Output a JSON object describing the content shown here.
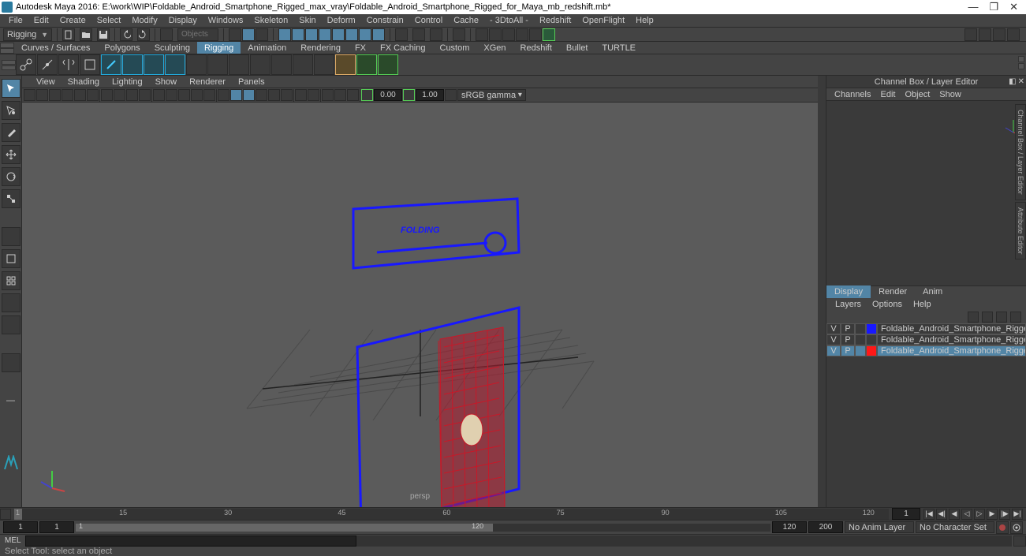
{
  "title": "Autodesk Maya 2016: E:\\work\\WIP\\Foldable_Android_Smartphone_Rigged_max_vray\\Foldable_Android_Smartphone_Rigged_for_Maya_mb_redshift.mb*",
  "menubar": [
    "File",
    "Edit",
    "Create",
    "Select",
    "Modify",
    "Display",
    "Windows",
    "Skeleton",
    "Skin",
    "Deform",
    "Constrain",
    "Control",
    "Cache",
    "- 3DtoAll -",
    "Redshift",
    "OpenFlight",
    "Help"
  ],
  "mode": "Rigging",
  "search_placeholder": "Objects",
  "shelf_tabs": [
    "Curves / Surfaces",
    "Polygons",
    "Sculpting",
    "Rigging",
    "Animation",
    "Rendering",
    "FX",
    "FX Caching",
    "Custom",
    "XGen",
    "Redshift",
    "Bullet",
    "TURTLE"
  ],
  "shelf_active": "Rigging",
  "panel_menu": [
    "View",
    "Shading",
    "Lighting",
    "Show",
    "Renderer",
    "Panels"
  ],
  "exposure": "0.00",
  "gamma": "1.00",
  "colorspace": "sRGB gamma",
  "viewport_label": "persp",
  "viewport_text": "FOLDING",
  "right_panel_title": "Channel Box / Layer Editor",
  "channel_menu": [
    "Channels",
    "Edit",
    "Object",
    "Show"
  ],
  "display_tabs": [
    "Display",
    "Render",
    "Anim"
  ],
  "display_active": "Display",
  "layer_menu": [
    "Layers",
    "Options",
    "Help"
  ],
  "layers": [
    {
      "v": "V",
      "p": "P",
      "blank": "",
      "color": "#1818ff",
      "name": "Foldable_Android_Smartphone_Rigged_controllers",
      "sel": false
    },
    {
      "v": "V",
      "p": "P",
      "blank": "",
      "color": "#3a3a3a",
      "name": "Foldable_Android_Smartphone_Rigged_bones",
      "sel": false
    },
    {
      "v": "V",
      "p": "P",
      "blank": "",
      "color": "#ff1818",
      "name": "Foldable_Android_Smartphone_Rigged",
      "sel": true
    }
  ],
  "side_tabs": [
    "Channel Box / Layer Editor",
    "Attribute Editor"
  ],
  "timeline_ticks": [
    "1",
    "15",
    "30",
    "45",
    "60",
    "75",
    "90",
    "105",
    "120"
  ],
  "current_frame": "1",
  "range_start_outer": "1",
  "range_start": "1",
  "range_end": "120",
  "range_end_outer": "120",
  "range_end2": "200",
  "anim_layer": "No Anim Layer",
  "char_set": "No Character Set",
  "cmd_label": "MEL",
  "help_text": "Select Tool: select an object"
}
